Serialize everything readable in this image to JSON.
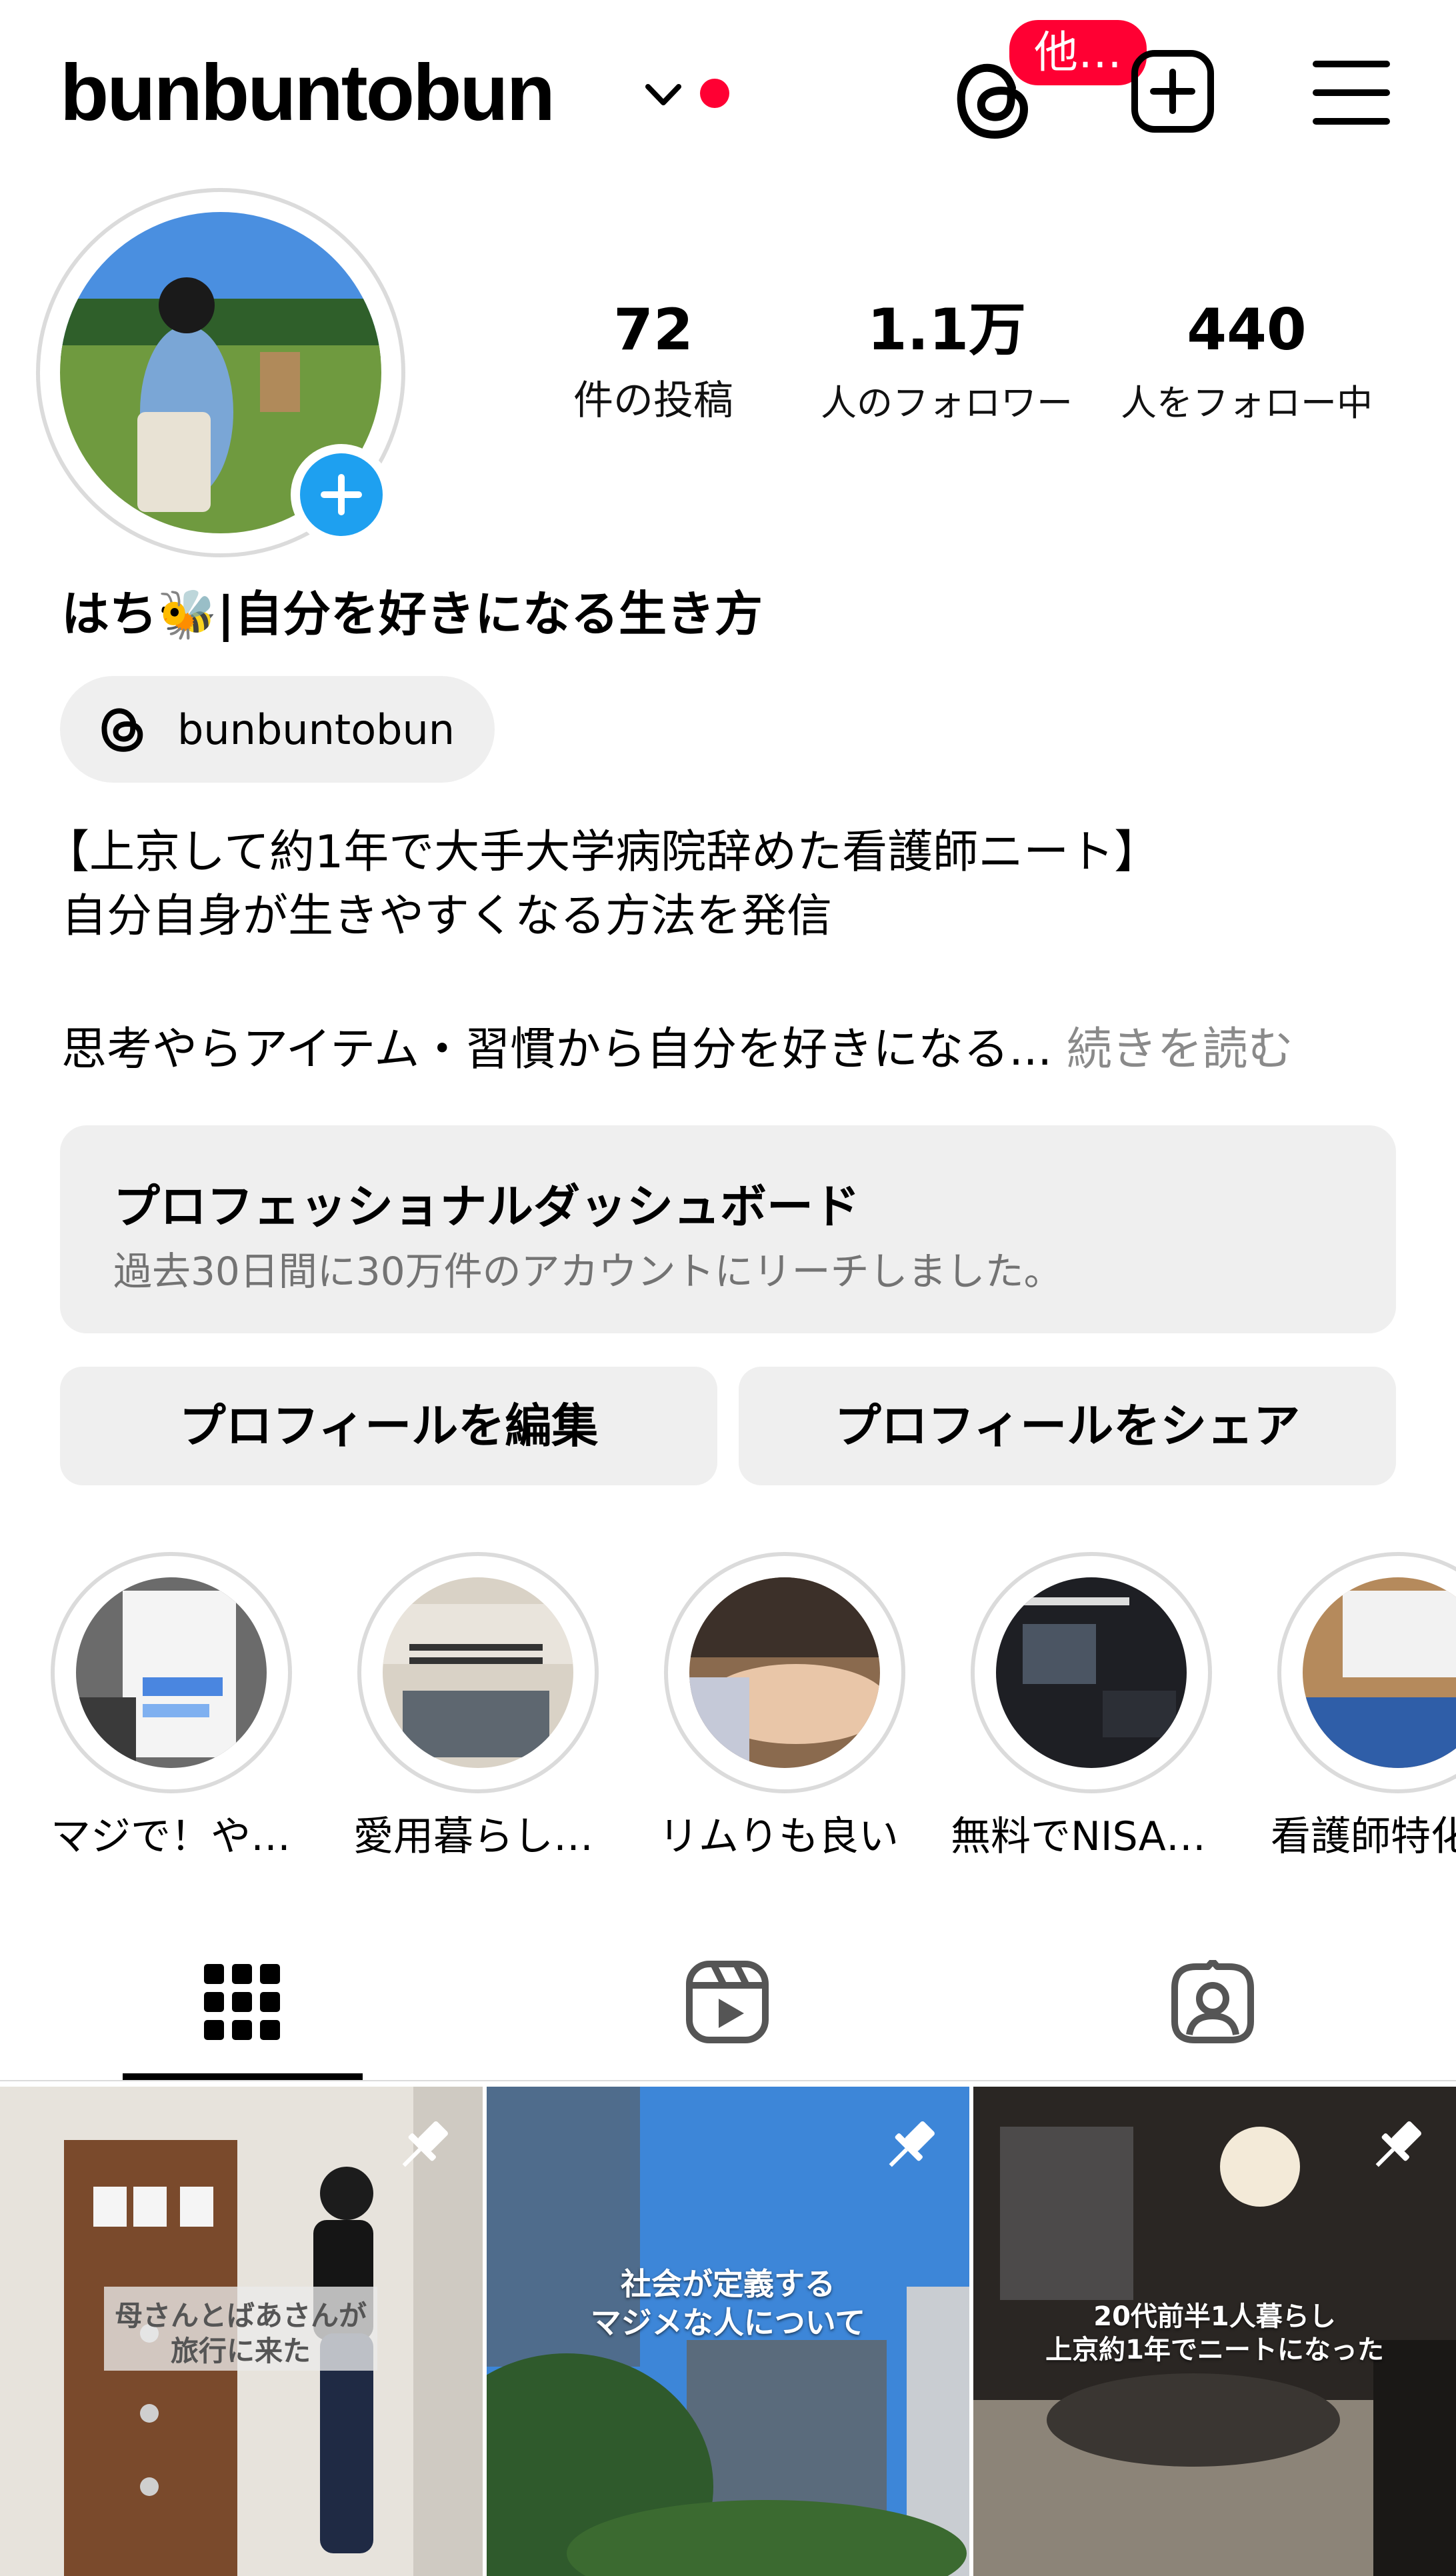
{
  "header": {
    "username": "bunbuntobun",
    "notification_badge": "他…",
    "accent_red": "#ff0033"
  },
  "profile": {
    "stats": [
      {
        "value": "72",
        "label": "件の投稿"
      },
      {
        "value": "1.1万",
        "label": "人のフォロワー"
      },
      {
        "value": "440",
        "label": "人をフォロー中"
      }
    ],
    "display_name": "はち🐝|自分を好きになる生き方",
    "threads_handle": "bunbuntobun",
    "bio_lines": [
      "【上京して約1年で大手大学病院辞めた看護師ニート】",
      "自分自身が生きやすくなる方法を発信",
      "思考やらアイテム・習慣から自分を好きになる..."
    ],
    "read_more": "続きを読む"
  },
  "dashboard": {
    "title": "プロフェッショナルダッシュボード",
    "subtitle": "過去30日間に30万件のアカウントにリーチしました。"
  },
  "buttons": {
    "edit_profile": "プロフィールを編集",
    "share_profile": "プロフィールをシェア"
  },
  "highlights": [
    {
      "label": "マジで！や…"
    },
    {
      "label": "愛用暮らし…"
    },
    {
      "label": "リムりも良い"
    },
    {
      "label": "無料でNISA…"
    },
    {
      "label": "看護師特化"
    }
  ],
  "posts": [
    {
      "caption_lines": [
        "母さんとばあさんが",
        "旅行に来た"
      ]
    },
    {
      "caption_lines": [
        "社会が定義する",
        "マジメな人について"
      ]
    },
    {
      "caption_lines": [
        "20代前半1人暮らし",
        "上京約1年でニートになった"
      ]
    }
  ],
  "icons": {
    "threads": "threads-icon",
    "add": "add-post-icon",
    "menu": "menu-icon",
    "grid": "grid-icon",
    "reels": "reels-icon",
    "tagged": "tagged-icon",
    "pin": "pin-icon"
  }
}
